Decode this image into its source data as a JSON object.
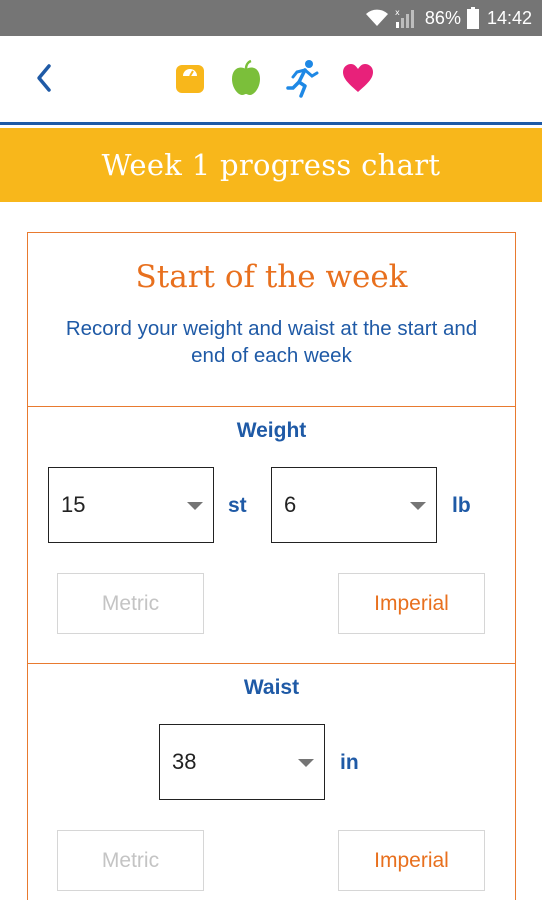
{
  "status_bar": {
    "battery_percent": "86%",
    "time": "14:42",
    "icons": [
      "wifi-icon",
      "signal-icon",
      "battery-icon"
    ]
  },
  "header": {
    "back_icon": "chevron-left-icon",
    "nav_icons": [
      "scale-icon",
      "apple-icon",
      "running-person-icon",
      "heart-icon"
    ],
    "colors": {
      "scale": "#f8b71b",
      "apple": "#7bbf3a",
      "runner": "#1e88e5",
      "heart": "#e8217a",
      "accent_line": "#1f5aa6"
    }
  },
  "banner": {
    "title": "Week 1 progress chart",
    "color": "#f8b71b"
  },
  "card": {
    "title": "Start of the week",
    "instruction": "Record your weight and waist at the start and end of each week",
    "border_color": "#e87a2f"
  },
  "weight": {
    "label": "Weight",
    "stones_value": "15",
    "stones_unit": "st",
    "pounds_value": "6",
    "pounds_unit": "lb",
    "metric_label": "Metric",
    "imperial_label": "Imperial",
    "selected_system": "Imperial"
  },
  "waist": {
    "label": "Waist",
    "inches_value": "38",
    "inches_unit": "in",
    "metric_label": "Metric",
    "imperial_label": "Imperial",
    "selected_system": "Imperial"
  }
}
